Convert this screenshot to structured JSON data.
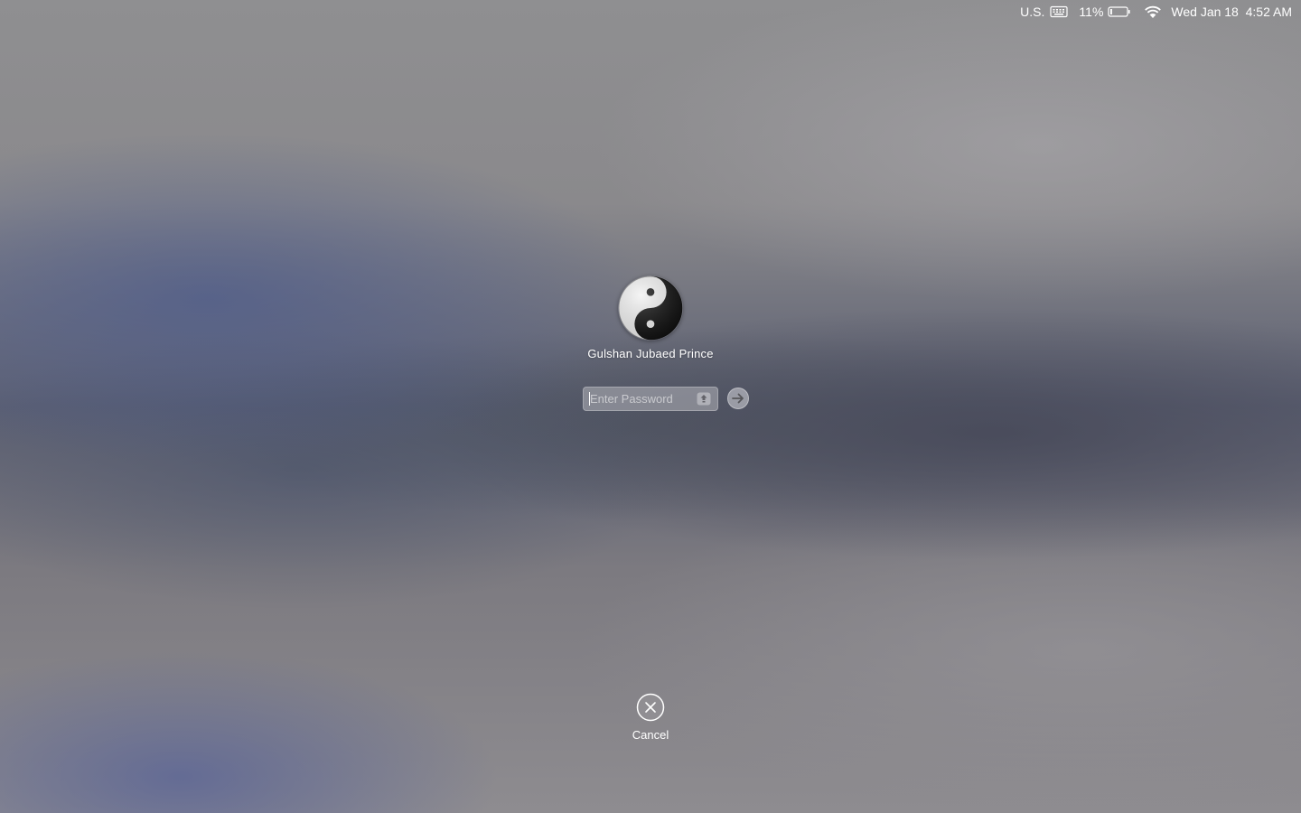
{
  "menubar": {
    "input_source": "U.S.",
    "battery_percent": "11%",
    "battery_level": 0.11,
    "datetime": "Wed Jan 18  4:52 AM",
    "icons": [
      "keyboard-icon",
      "battery-icon",
      "wifi-icon"
    ]
  },
  "login": {
    "avatar_icon": "yin-yang-avatar",
    "username": "Gulshan Jubaed Prince",
    "password_placeholder": "Enter Password",
    "password_value": "",
    "submit_icon": "arrow-right-icon",
    "key_icon": "keychain-icon"
  },
  "cancel": {
    "label": "Cancel",
    "icon": "close-circle-icon"
  },
  "colors": {
    "text": "#ffffff",
    "wallpaper_base": "#8c8b8f",
    "wallpaper_blue": "#4e5c8c",
    "wallpaper_dark": "#46485a"
  }
}
